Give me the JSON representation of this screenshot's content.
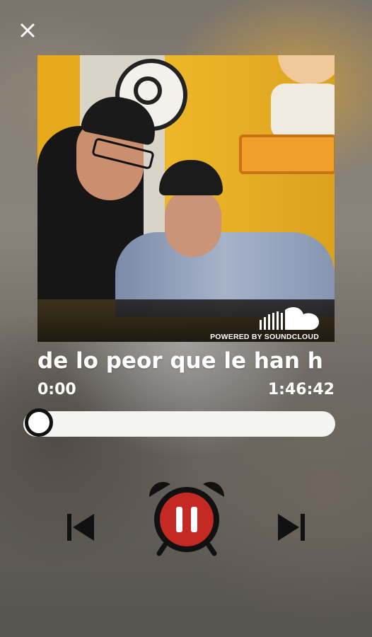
{
  "player": {
    "close_icon": "close-icon",
    "artwork": {
      "powered_by": "POWERED BY SOUNDCLOUD",
      "logo_icon": "soundcloud-logo-icon"
    },
    "track_title": "de lo peor que le han h",
    "time_current": "0:00",
    "time_total": "1:46:42",
    "progress": 0.0,
    "controls": {
      "prev_icon": "skip-previous-icon",
      "play_icon": "pause-alarm-clock-icon",
      "next_icon": "skip-next-icon"
    },
    "colors": {
      "accent": "#c42a23",
      "dark": "#111111",
      "track": "#f4f4f2"
    }
  }
}
